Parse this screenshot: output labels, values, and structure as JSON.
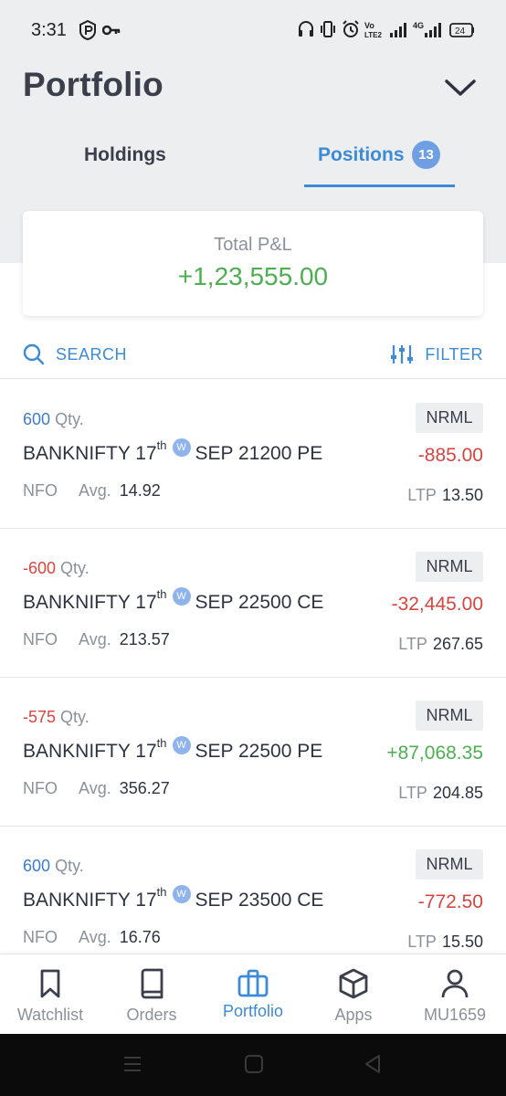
{
  "status_bar": {
    "time": "3:31",
    "icons": [
      "p-app-icon",
      "key-icon",
      "headset-icon",
      "vibrate-icon",
      "alarm-icon",
      "volte-icon",
      "signal-icon",
      "signal-4g-icon"
    ],
    "battery": "24"
  },
  "header": {
    "title": "Portfolio",
    "tabs": [
      {
        "label": "Holdings",
        "active": false
      },
      {
        "label": "Positions",
        "active": true,
        "badge": "13"
      }
    ]
  },
  "summary": {
    "label": "Total P&L",
    "value": "+1,23,555.00"
  },
  "toolbar": {
    "search_label": "SEARCH",
    "filter_label": "FILTER"
  },
  "positions": [
    {
      "qty": "600",
      "qty_unit": "Qty.",
      "symbol": "BANKNIFTY 17",
      "sup": "th",
      "weekly": "W",
      "contract": "SEP 21200 PE",
      "exchange": "NFO",
      "avg_label": "Avg.",
      "avg": "14.92",
      "product": "NRML",
      "pnl": "-885.00",
      "ltp_label": "LTP",
      "ltp": "13.50"
    },
    {
      "qty": "-600",
      "qty_unit": "Qty.",
      "symbol": "BANKNIFTY 17",
      "sup": "th",
      "weekly": "W",
      "contract": "SEP 22500 CE",
      "exchange": "NFO",
      "avg_label": "Avg.",
      "avg": "213.57",
      "product": "NRML",
      "pnl": "-32,445.00",
      "ltp_label": "LTP",
      "ltp": "267.65"
    },
    {
      "qty": "-575",
      "qty_unit": "Qty.",
      "symbol": "BANKNIFTY 17",
      "sup": "th",
      "weekly": "W",
      "contract": "SEP 22500 PE",
      "exchange": "NFO",
      "avg_label": "Avg.",
      "avg": "356.27",
      "product": "NRML",
      "pnl": "+87,068.35",
      "ltp_label": "LTP",
      "ltp": "204.85"
    },
    {
      "qty": "600",
      "qty_unit": "Qty.",
      "symbol": "BANKNIFTY 17",
      "sup": "th",
      "weekly": "W",
      "contract": "SEP 23500 CE",
      "exchange": "NFO",
      "avg_label": "Avg.",
      "avg": "16.76",
      "product": "NRML",
      "pnl": "-772.50",
      "ltp_label": "LTP",
      "ltp": "15.50"
    }
  ],
  "bottom_nav": [
    {
      "label": "Watchlist",
      "icon": "bookmark-icon",
      "active": false
    },
    {
      "label": "Orders",
      "icon": "book-icon",
      "active": false
    },
    {
      "label": "Portfolio",
      "icon": "briefcase-icon",
      "active": true
    },
    {
      "label": "Apps",
      "icon": "cube-icon",
      "active": false
    },
    {
      "label": "MU1659",
      "icon": "user-icon",
      "active": false
    }
  ],
  "colors": {
    "accent": "#3d8ad6",
    "profit": "#4caf50",
    "loss": "#d6453f",
    "header_bg": "#eceef0"
  }
}
